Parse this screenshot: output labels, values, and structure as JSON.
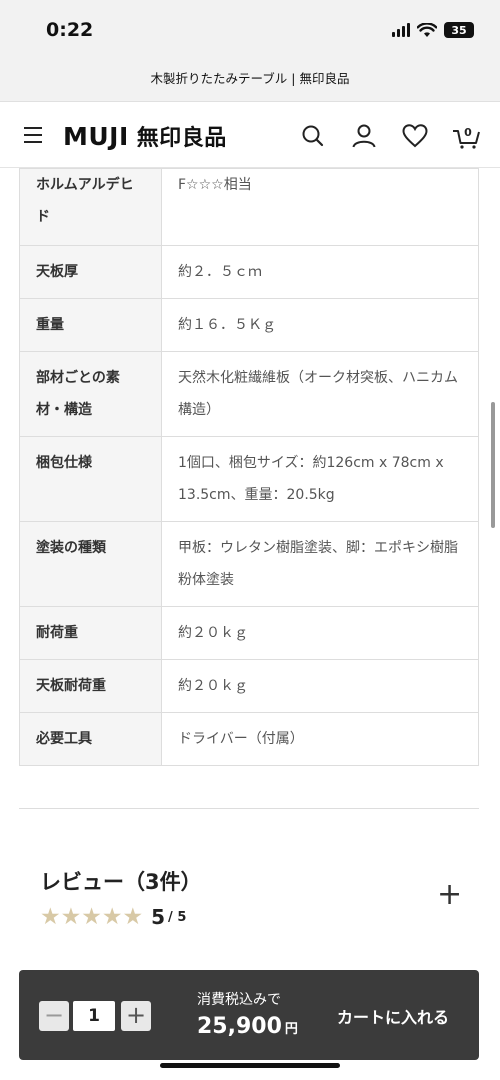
{
  "status_bar": {
    "time": "0:22",
    "battery": "35"
  },
  "browser": {
    "page_title": "木製折りたたみテーブル | 無印良品"
  },
  "header": {
    "logo": "MUJI",
    "logo_jp": "無印良品",
    "cart_count": "0"
  },
  "spec_rows": [
    {
      "label": "ホルムアルデヒド",
      "value": "F☆☆☆相当"
    },
    {
      "label": "天板厚",
      "value": "約２．５ｃｍ"
    },
    {
      "label": "重量",
      "value": "約１６．５Ｋｇ"
    },
    {
      "label": "部材ごとの素材・構造",
      "value": "天然木化粧繊維板（オーク材突板、ハニカム構造）"
    },
    {
      "label": "梱包仕様",
      "value": "1個口、梱包サイズ：約126cm x 78cm x 13.5cm、重量：20.5kg"
    },
    {
      "label": "塗装の種類",
      "value": "甲板：ウレタン樹脂塗装、脚：エポキシ樹脂粉体塗装"
    },
    {
      "label": "耐荷重",
      "value": "約２０ｋｇ"
    },
    {
      "label": "天板耐荷重",
      "value": "約２０ｋｇ"
    },
    {
      "label": "必要工具",
      "value": "ドライバー（付属）"
    }
  ],
  "reviews": {
    "title": "レビュー（3件）",
    "rating": "5",
    "rating_max": "/ 5",
    "stars_filled": 5,
    "star_color": "#d8c9a6"
  },
  "cart_bar": {
    "minus": "−",
    "quantity": "1",
    "plus": "+",
    "tax_label": "消費税込みで",
    "price": "25,900",
    "currency": "円",
    "add_to_cart": "カートに入れる"
  }
}
